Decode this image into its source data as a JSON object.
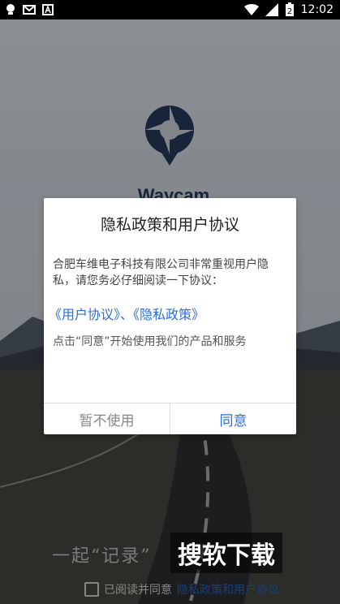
{
  "status_bar": {
    "time": "12:02",
    "battery_level": "2",
    "icons": [
      "lightbulb-icon",
      "mail-icon",
      "a-icon",
      "wifi-icon",
      "signal-icon",
      "battery-icon"
    ]
  },
  "splash": {
    "brand": "Waycam",
    "slogan": "一起“记录”",
    "watermark": "搜软下载"
  },
  "dialog": {
    "title": "隐私政策和用户协议",
    "body": "合肥车维电子科技有限公司非常重视用户隐私，请您务必仔细阅读一下协议：",
    "link_user_agreement": "《用户协议》",
    "link_separator": "、",
    "link_privacy_policy": "《隐私政策》",
    "note": "点击“同意”开始使用我们的产品和服务",
    "cancel_label": "暂不使用",
    "agree_label": "同意"
  },
  "footer": {
    "agree_prefix": "已阅读并同意",
    "agree_link": "隐私政策和用户协议"
  },
  "colors": {
    "accent": "#2d6fd0",
    "brand": "#2a3f63"
  }
}
